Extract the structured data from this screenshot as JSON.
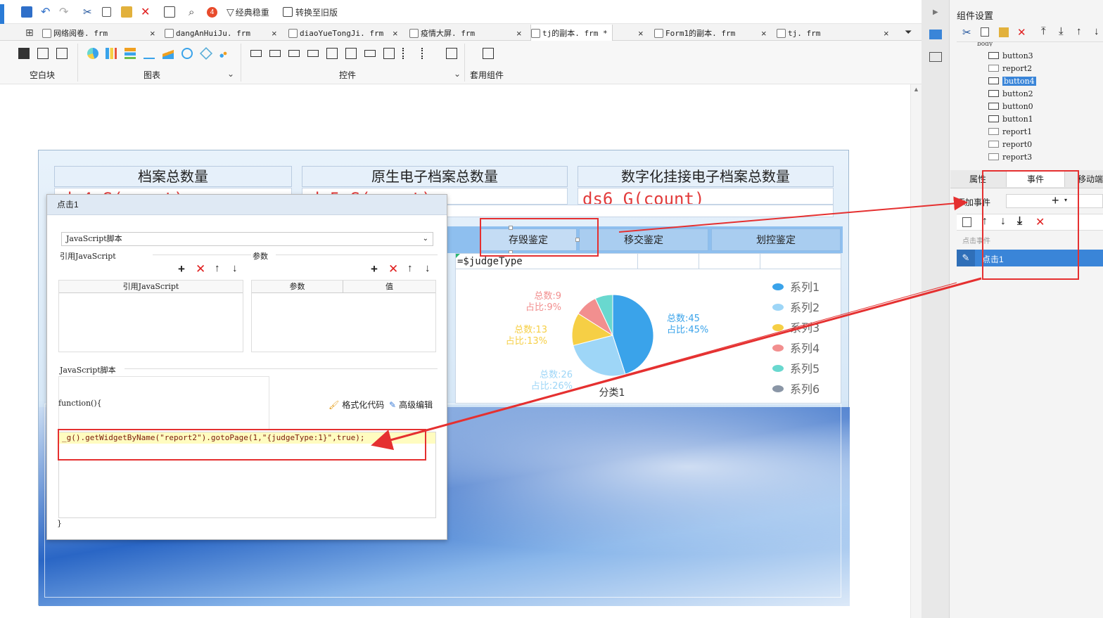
{
  "toolbar": {
    "badge_count": "4",
    "classic_btn": "经典稳重",
    "convert_btn": "转换至旧版"
  },
  "tabs": [
    {
      "label": "网络阅卷. frm"
    },
    {
      "label": "dangAnHuiJu. frm"
    },
    {
      "label": "diaoYueTongJi. frm"
    },
    {
      "label": "疫情大屏. frm"
    },
    {
      "label": "tj的副本. frm *"
    },
    {
      "label": "Form1的副本. frm"
    },
    {
      "label": "tj. frm"
    }
  ],
  "ribbon": {
    "group_blank": "空白块",
    "group_chart": "图表",
    "group_widget": "控件",
    "group_suite": "套用组件"
  },
  "form": {
    "kpi_headers": [
      "档案总数量",
      "原生电子档案总数量",
      "数字化挂接电子档案总数量"
    ],
    "kpi_values": [
      "ds4 S(count)",
      "ds5 S(count)",
      "ds6 G(count)"
    ],
    "nav_buttons": [
      "存毁鉴定",
      "移交鉴定",
      "划控鉴定"
    ],
    "chart_header": "=$judgeType"
  },
  "chart_data": {
    "type": "pie",
    "title": "",
    "categories": [
      "系列1",
      "系列2",
      "系列3",
      "系列4",
      "系列5",
      "系列6"
    ],
    "values": [
      45,
      26,
      13,
      9,
      7,
      0
    ],
    "colors": [
      "#3aa3ea",
      "#9ed6f7",
      "#f6cf45",
      "#f28f8f",
      "#69d8cf",
      "#8a96a6"
    ],
    "data_labels": [
      {
        "total": "总数:45",
        "pct": "占比:45%"
      },
      {
        "total": "总数:26",
        "pct": "占比:26%"
      },
      {
        "total": "总数:13",
        "pct": "占比:13%"
      },
      {
        "total": "总数:9",
        "pct": "占比:9%"
      }
    ],
    "xlabel": "分类1",
    "legend": "right"
  },
  "dialog": {
    "title": "点击1",
    "type_select": "JavaScript脚本",
    "ref_js_label": "引用JavaScript",
    "params_label": "参数",
    "ref_js_col": "引用JavaScript",
    "param_col": "参数",
    "value_col": "值",
    "script_label": "JavaScript脚本",
    "function_open": "function(){",
    "code_line": "_g().getWidgetByName(\"report2\").gotoPage(1,\"{judgeType:1}\",true);",
    "function_close": "}",
    "format_code": "格式化代码",
    "advanced_edit": "高级编辑"
  },
  "right_panel": {
    "title": "组件设置",
    "tree_top": "body",
    "tree_items": [
      {
        "label": "button3",
        "type": "button"
      },
      {
        "label": "report2",
        "type": "report"
      },
      {
        "label": "button4",
        "type": "button",
        "selected": true
      },
      {
        "label": "button2",
        "type": "button"
      },
      {
        "label": "button0",
        "type": "button"
      },
      {
        "label": "button1",
        "type": "button"
      },
      {
        "label": "report1",
        "type": "report"
      },
      {
        "label": "report0",
        "type": "report"
      },
      {
        "label": "report3",
        "type": "report"
      }
    ],
    "tabs": [
      "属性",
      "事件",
      "移动端"
    ],
    "add_event": "添加事件",
    "event_group": "点击事件",
    "event_item": "点击1"
  }
}
